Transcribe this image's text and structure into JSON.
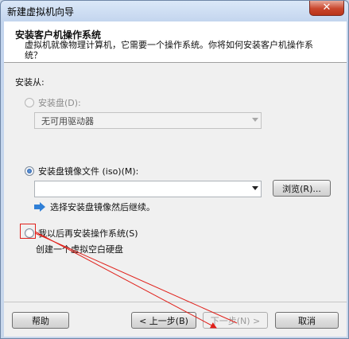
{
  "window": {
    "title": "新建虚拟机向导",
    "close_glyph": "✕"
  },
  "header": {
    "title": "安装客户机操作系统",
    "description": "虚拟机就像物理计算机，它需要一个操作系统。你将如何安装客户机操作系统？"
  },
  "install_from": {
    "label": "安装从:",
    "disc": {
      "label": "安装盘(D):",
      "drive_value": "无可用驱动器"
    },
    "iso": {
      "label": "安装盘镜像文件 (iso)(M):",
      "path_value": "",
      "browse_label": "浏览(R)..."
    },
    "hint": "选择安装盘镜像然后继续。",
    "later": {
      "label": "我以后再安装操作系统(S)",
      "description": "创建一个虚拟空白硬盘"
    }
  },
  "footer": {
    "help_label": "帮助",
    "back_label": "< 上一步(B)",
    "next_label": "下一步(N) >",
    "cancel_label": "取消"
  },
  "annotation_color": "#e0201a"
}
